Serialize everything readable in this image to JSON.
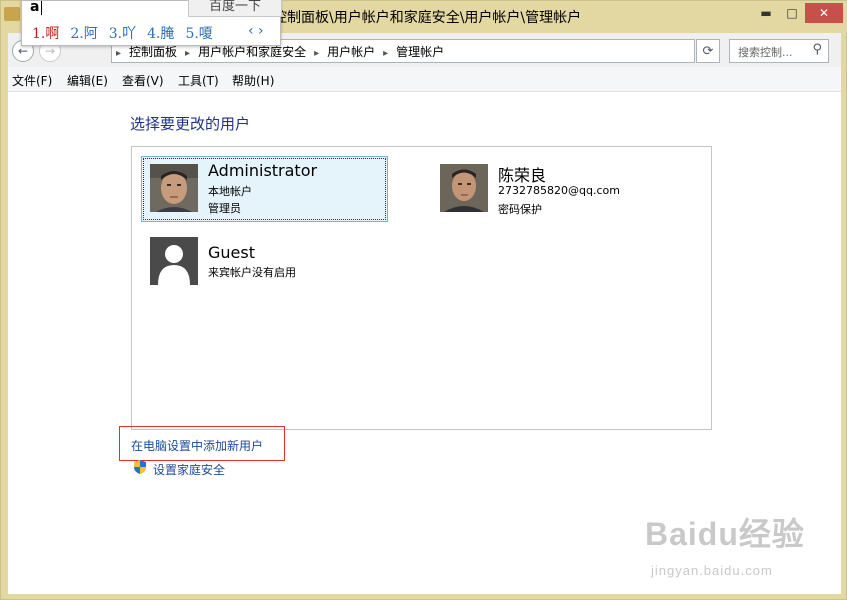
{
  "window": {
    "title": "控制面板\\用户帐户和家庭安全\\用户帐户\\管理帐户",
    "min_glyph": "▬",
    "max_glyph": "□",
    "close_glyph": "✕"
  },
  "ime": {
    "input": "a",
    "baidu_button": "百度一下",
    "candidates": [
      "1.啊",
      "2.阿",
      "3.吖",
      "4.腌",
      "5.嗄"
    ],
    "arrows": "‹ ›"
  },
  "address": {
    "crumbs": [
      "控制面板",
      "用户帐户和家庭安全",
      "用户帐户",
      "管理帐户"
    ],
    "refresh_glyph": "⟳",
    "search_placeholder": "搜索控制...",
    "search_glyph": "⚲"
  },
  "menu": {
    "file": "文件(F)",
    "edit": "编辑(E)",
    "view": "查看(V)",
    "tools": "工具(T)",
    "help": "帮助(H)"
  },
  "main": {
    "heading": "选择要更改的用户",
    "accounts": [
      {
        "name": "Administrator",
        "line1": "本地帐户",
        "line2": "管理员"
      },
      {
        "name": "陈荣良",
        "line1": "2732785820@qq.com",
        "line2": "密码保护"
      },
      {
        "name": "Guest",
        "line1": "来宾帐户没有启用"
      }
    ],
    "add_user_link": "在电脑设置中添加新用户",
    "family_safety_link": "设置家庭安全"
  },
  "watermark": {
    "logo": "Baidu经验",
    "url": "jingyan.baidu.com"
  }
}
